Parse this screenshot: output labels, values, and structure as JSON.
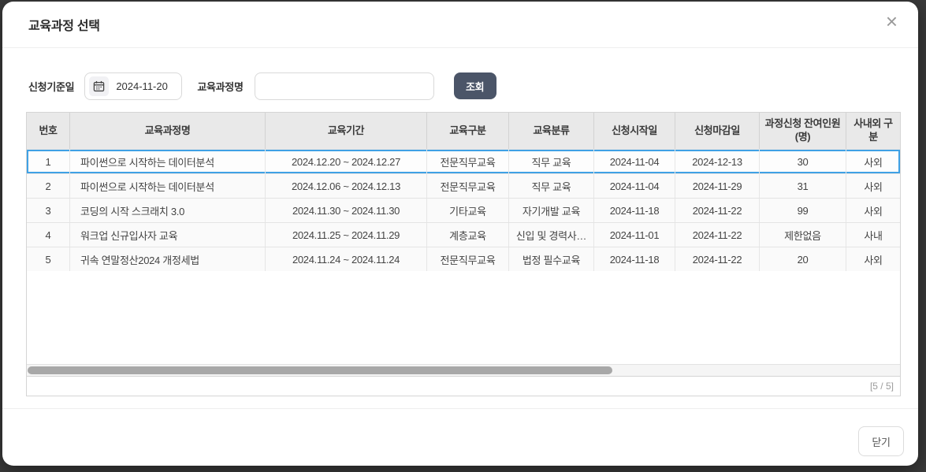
{
  "dialog": {
    "title": "교육과정 선택",
    "close_glyph": "×"
  },
  "filters": {
    "date_label": "신청기준일",
    "date_value": "2024-11-20",
    "course_label": "교육과정명",
    "course_value": "",
    "search_button": "조회"
  },
  "table": {
    "headers": [
      "번호",
      "교육과정명",
      "교육기간",
      "교육구분",
      "교육분류",
      "신청시작일",
      "신청마감일",
      "과정신청 잔여인원(명)",
      "사내외 구분"
    ],
    "rows": [
      [
        "1",
        "파이썬으로 시작하는 데이터분석",
        "2024.12.20 ~ 2024.12.27",
        "전문직무교육",
        "직무 교육",
        "2024-11-04",
        "2024-12-13",
        "30",
        "사외"
      ],
      [
        "2",
        "파이썬으로 시작하는 데이터분석",
        "2024.12.06 ~ 2024.12.13",
        "전문직무교육",
        "직무 교육",
        "2024-11-04",
        "2024-11-29",
        "31",
        "사외"
      ],
      [
        "3",
        "코딩의 시작 스크래치 3.0",
        "2024.11.30 ~ 2024.11.30",
        "기타교육",
        "자기개발 교육",
        "2024-11-18",
        "2024-11-22",
        "99",
        "사외"
      ],
      [
        "4",
        "워크업 신규입사자 교육",
        "2024.11.25 ~ 2024.11.29",
        "계층교육",
        "신입 및 경력사…",
        "2024-11-01",
        "2024-11-22",
        "제한없음",
        "사내"
      ],
      [
        "5",
        "귀속 연말정산2024 개정세법",
        "2024.11.24 ~ 2024.11.24",
        "전문직무교육",
        "법정 필수교육",
        "2024-11-18",
        "2024-11-22",
        "20",
        "사외"
      ]
    ],
    "selected_row_index": 0,
    "record_count": "[5 / 5]"
  },
  "footer": {
    "close_button": "닫기"
  },
  "colors": {
    "accent_selected_row": "#3fa1e5",
    "search_button_bg": "#4b5568",
    "backdrop": "#3a3a3a",
    "header_bg": "#e9e9e9"
  }
}
